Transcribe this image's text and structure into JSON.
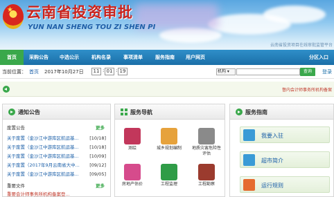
{
  "header": {
    "title_cn": "云南省投资审批",
    "title_en": "YUN NAN SHENG TOU ZI SHEN PI",
    "note": "云南省投资项目在线审批监管平台"
  },
  "nav": {
    "items": [
      {
        "label": "首页",
        "active": true
      },
      {
        "label": "采购公告",
        "active": false
      },
      {
        "label": "中选公示",
        "active": false
      },
      {
        "label": "机构名录",
        "active": false
      },
      {
        "label": "事项清单",
        "active": false
      },
      {
        "label": "服务指南",
        "active": false
      },
      {
        "label": "用户网页",
        "active": false
      }
    ],
    "right_item": "分区入口"
  },
  "location": {
    "prefix": "当前位置：",
    "crumb": "首页",
    "date": "2017年10月27日",
    "clock": {
      "h": "11",
      "m": "01",
      "s": "19"
    },
    "search_select": "机构 ▾",
    "search_placeholder": "",
    "search_button": "查询",
    "login": "登录"
  },
  "notice": {
    "text": "督内会计师事务所机构备案"
  },
  "announcements": {
    "title": "通知公告",
    "section1": "废置公告",
    "more": "更多",
    "items": [
      {
        "title": "关于废置（金沙江中游库区航运基...",
        "date": "[10/18]"
      },
      {
        "title": "关于废置（金沙江中游库区航运基...",
        "date": "[10/18]"
      },
      {
        "title": "关于废置（金沙江中游库区航运基...",
        "date": "[10/09]"
      },
      {
        "title": "关于废置（2017年9月云南省大中...",
        "date": "[09/12]"
      },
      {
        "title": "关于废置（金沙江中游库区航运基...",
        "date": "[09/05]"
      }
    ],
    "section2": "重要文件",
    "more2": "更多",
    "partial": "重要会计师事务所机构备案登..."
  },
  "services": {
    "title": "服务导航",
    "items": [
      {
        "label": "测绘",
        "color": "#c2375b"
      },
      {
        "label": "城乡规划编制",
        "color": "#e6a23c"
      },
      {
        "label": "地质灾害危险性评估",
        "color": "#8a8a8a"
      },
      {
        "label": "房地产估价",
        "color": "#d64b8c"
      },
      {
        "label": "工程监理",
        "color": "#2f9c47"
      },
      {
        "label": "工程勘察",
        "color": "#9b3b2e"
      }
    ]
  },
  "guide": {
    "title": "服务指南",
    "items": [
      {
        "label": "我要入驻",
        "color": "#3a9bd6"
      },
      {
        "label": "超市简介",
        "color": "#3a9bd6"
      },
      {
        "label": "运行规则",
        "color": "#e56b2f"
      }
    ]
  },
  "colors": {
    "accent_green": "#3aa84b",
    "nav_blue": "#1b6fa8",
    "title_red": "#c9231d"
  }
}
